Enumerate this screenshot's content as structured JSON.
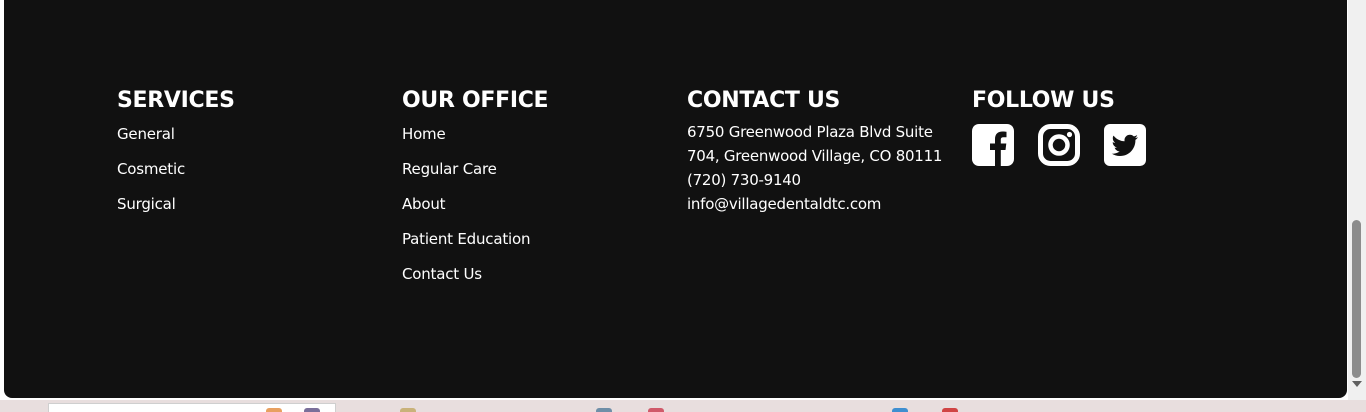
{
  "footer": {
    "services": {
      "heading": "SERVICES",
      "items": [
        "General",
        "Cosmetic",
        "Surgical"
      ]
    },
    "office": {
      "heading": "OUR OFFICE",
      "items": [
        "Home",
        "Regular Care",
        "About",
        "Patient Education",
        "Contact Us"
      ]
    },
    "contact": {
      "heading": "CONTACT US",
      "address_line1": "6750 Greenwood Plaza Blvd Suite",
      "address_line2": "704, Greenwood Village, CO 80111",
      "phone": "(720) 730-9140",
      "email": "info@villagedentaldtc.com"
    },
    "follow": {
      "heading": "FOLLOW US",
      "icons": [
        "facebook-icon",
        "instagram-icon",
        "twitter-icon"
      ]
    }
  },
  "colors": {
    "footer_bg": "#111111",
    "text": "#ffffff",
    "page_bg": "#e6dcdc"
  }
}
